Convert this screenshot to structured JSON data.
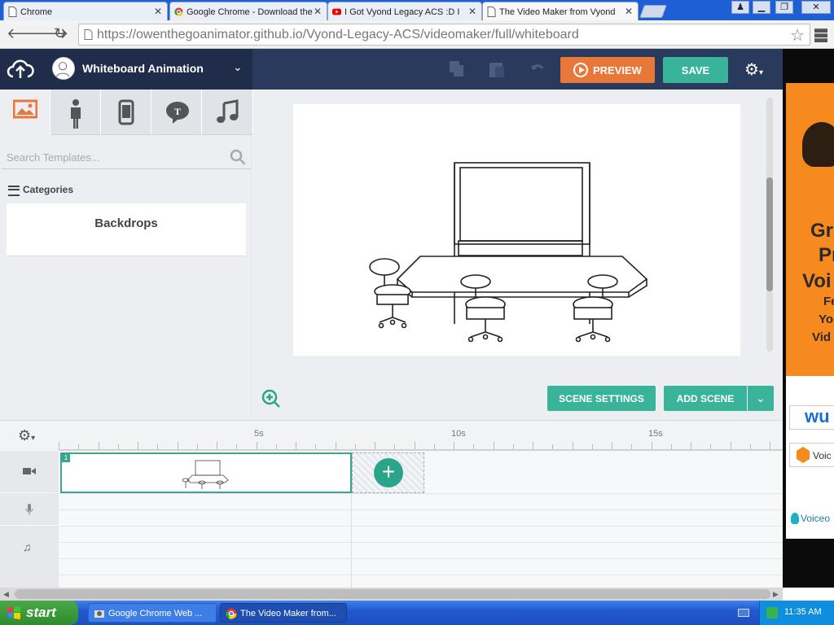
{
  "browser": {
    "tabs": [
      {
        "label": "Chrome",
        "icon": "page-icon",
        "active": false
      },
      {
        "label": "Google Chrome - Download the",
        "icon": "chrome-icon",
        "active": false
      },
      {
        "label": "I Got Vyond Legacy ACS :D I",
        "icon": "youtube-icon",
        "active": false
      },
      {
        "label": "The Video Maker from Vyond",
        "icon": "page-icon",
        "active": true
      }
    ],
    "url": "https://owenthegoanimator.github.io/Vyond-Legacy-ACS/videomaker/full/whiteboard"
  },
  "app": {
    "title": "Whiteboard Animation",
    "preview_label": "PREVIEW",
    "save_label": "SAVE",
    "accent_orange": "#e8773a",
    "accent_teal": "#39b39a",
    "header_color": "#2a3a5c"
  },
  "library": {
    "tabs": [
      "image-icon",
      "character-icon",
      "prop-icon",
      "text-bubble-icon",
      "music-icon"
    ],
    "search_placeholder": "Search Templates...",
    "categories_label": "Categories",
    "items": [
      "Backdrops"
    ]
  },
  "stage": {
    "scene_settings_label": "SCENE SETTINGS",
    "add_scene_label": "ADD SCENE"
  },
  "timeline": {
    "ruler_labels": [
      "5s",
      "10s",
      "15s"
    ],
    "scene_number": "1"
  },
  "ad": {
    "lines": [
      "Gr",
      "Pr",
      "Voi",
      "Fe",
      "Yo",
      "Vid"
    ],
    "brand1": "wu",
    "brand2": "Voic",
    "brand3": "Voiceo"
  },
  "taskbar": {
    "start_label": "start",
    "items": [
      "Google Chrome Web ...",
      "The Video Maker from..."
    ],
    "clock": "11:35 AM"
  }
}
